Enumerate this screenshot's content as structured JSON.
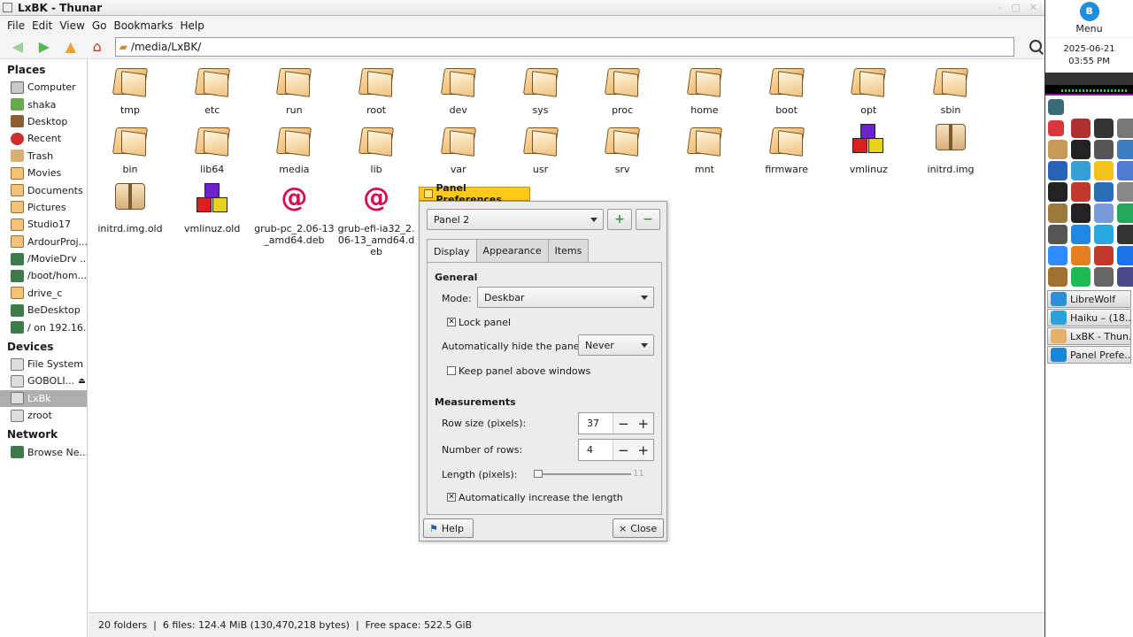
{
  "window": {
    "title": "LxBK - Thunar"
  },
  "menubar": [
    "File",
    "Edit",
    "View",
    "Go",
    "Bookmarks",
    "Help"
  ],
  "address": {
    "path": "/media/LxBK/"
  },
  "sidebar": {
    "places_header": "Places",
    "places": [
      {
        "label": "Computer",
        "icon": "computer-icon"
      },
      {
        "label": "shaka",
        "icon": "home-icon"
      },
      {
        "label": "Desktop",
        "icon": "desktop-icon"
      },
      {
        "label": "Recent",
        "icon": "recent-icon"
      },
      {
        "label": "Trash",
        "icon": "trash-icon"
      },
      {
        "label": "Movies",
        "icon": "folder-icon"
      },
      {
        "label": "Documents",
        "icon": "folder-icon"
      },
      {
        "label": "Pictures",
        "icon": "folder-icon"
      },
      {
        "label": "Studio17",
        "icon": "folder-icon"
      },
      {
        "label": "ArdourProj...",
        "icon": "folder-icon"
      },
      {
        "label": "/MovieDrv ...",
        "icon": "network-icon"
      },
      {
        "label": "/boot/hom...",
        "icon": "network-icon"
      },
      {
        "label": "drive_c",
        "icon": "folder-icon"
      },
      {
        "label": "BeDesktop",
        "icon": "network-icon"
      },
      {
        "label": "/ on 192.16...",
        "icon": "network-icon"
      }
    ],
    "devices_header": "Devices",
    "devices": [
      {
        "label": "File System",
        "icon": "drive-icon"
      },
      {
        "label": "GOBOLI...",
        "icon": "drive-icon"
      },
      {
        "label": "LxBk",
        "icon": "drive-icon"
      },
      {
        "label": "zroot",
        "icon": "drive-icon"
      }
    ],
    "network_header": "Network",
    "network": [
      {
        "label": "Browse Ne...",
        "icon": "network-icon"
      }
    ]
  },
  "files": [
    {
      "name": "tmp",
      "type": "folder"
    },
    {
      "name": "etc",
      "type": "folder"
    },
    {
      "name": "run",
      "type": "folder"
    },
    {
      "name": "root",
      "type": "folder"
    },
    {
      "name": "dev",
      "type": "folder"
    },
    {
      "name": "sys",
      "type": "folder"
    },
    {
      "name": "proc",
      "type": "folder"
    },
    {
      "name": "home",
      "type": "folder"
    },
    {
      "name": "boot",
      "type": "folder"
    },
    {
      "name": "opt",
      "type": "folder"
    },
    {
      "name": "sbin",
      "type": "folder"
    },
    {
      "name": "bin",
      "type": "folder"
    },
    {
      "name": "lib64",
      "type": "folder"
    },
    {
      "name": "media",
      "type": "folder"
    },
    {
      "name": "lib",
      "type": "folder"
    },
    {
      "name": "var",
      "type": "folder"
    },
    {
      "name": "usr",
      "type": "folder"
    },
    {
      "name": "srv",
      "type": "folder"
    },
    {
      "name": "mnt",
      "type": "folder"
    },
    {
      "name": "firmware",
      "type": "folder"
    },
    {
      "name": "vmlinuz",
      "type": "kernel"
    },
    {
      "name": "initrd.img",
      "type": "package"
    },
    {
      "name": "initrd.img.old",
      "type": "package"
    },
    {
      "name": "vmlinuz.old",
      "type": "kernel"
    },
    {
      "name": "grub-pc_2.06-13_amd64.deb",
      "type": "deb"
    },
    {
      "name": "grub-efi-ia32_2.06-13_amd64.deb",
      "type": "deb"
    }
  ],
  "status": {
    "text": "20 folders  |  6 files: 124.4 MiB (130,470,218 bytes)  |  Free space: 522.5 GiB"
  },
  "dialog": {
    "title": "Panel Preferences",
    "panel_select": "Panel 2",
    "tabs": [
      "Display",
      "Appearance",
      "Items"
    ],
    "general_header": "General",
    "mode_label": "Mode:",
    "mode_value": "Deskbar",
    "lock_panel": "Lock panel",
    "autohide_label": "Automatically hide the panel:",
    "autohide_value": "Never",
    "keep_above": "Keep panel above windows",
    "measurements_header": "Measurements",
    "row_size_label": "Row size (pixels):",
    "row_size_value": "37",
    "rows_label": "Number of rows:",
    "rows_value": "4",
    "length_label": "Length (pixels):",
    "length_value": "11",
    "auto_length": "Automatically increase the length",
    "help_button": "Help",
    "close_button": "Close"
  },
  "dock": {
    "menu_label": "Menu",
    "date": "2025-06-21",
    "time": "03:55 PM",
    "tasks": [
      {
        "label": "LibreWolf",
        "color": "#2b8fd9"
      },
      {
        "label": "Haiku – (18...",
        "color": "#2aa3dd"
      },
      {
        "label": "LxBK - Thun...",
        "color": "#e6b06a"
      },
      {
        "label": "Panel Prefe...",
        "color": "#1c86d6"
      }
    ]
  },
  "colors": {
    "accent": "#ffcb18",
    "selection": "#aeaeae"
  }
}
